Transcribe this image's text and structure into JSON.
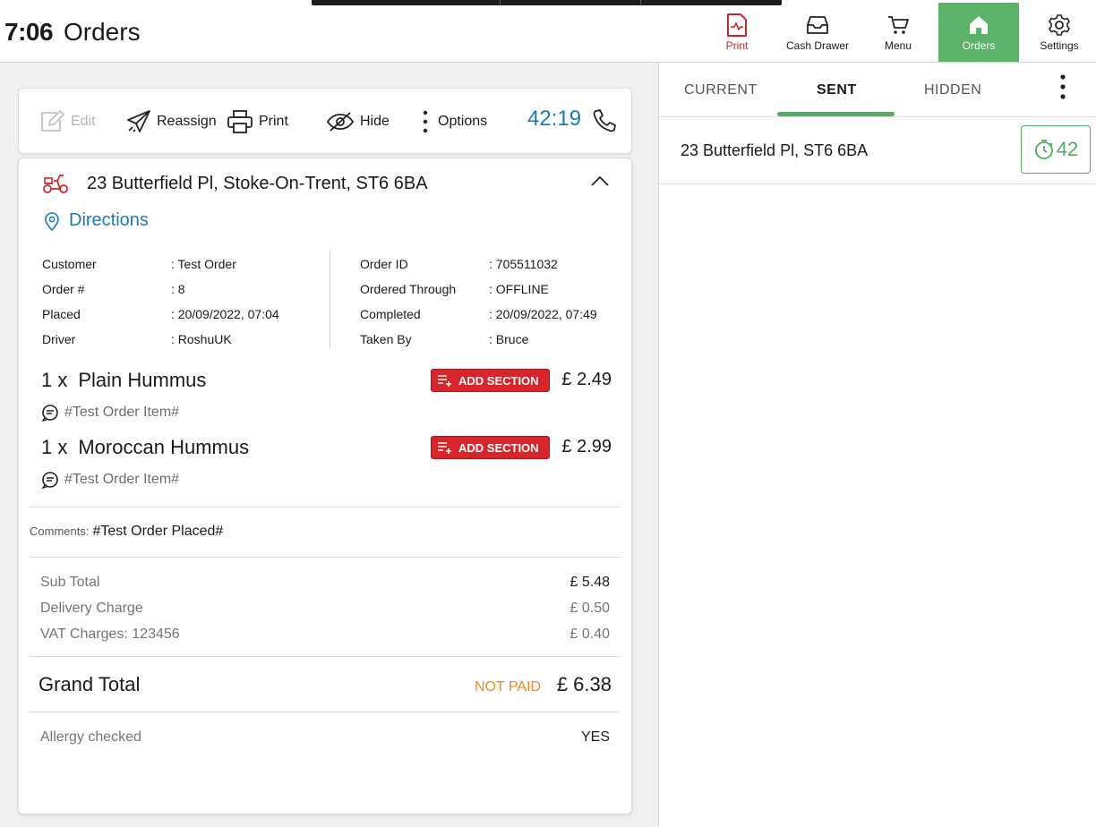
{
  "header": {
    "clock": "7:06",
    "title": "Orders",
    "nav": [
      {
        "label": "Print",
        "icon": "print-receipt-icon",
        "color": "#c9262a"
      },
      {
        "label": "Cash Drawer",
        "icon": "cash-drawer-icon"
      },
      {
        "label": "Menu",
        "icon": "cart-icon"
      },
      {
        "label": "Orders",
        "icon": "home-icon",
        "active": true,
        "color": "#5bb36a"
      },
      {
        "label": "Settings",
        "icon": "gear-icon"
      }
    ]
  },
  "toolbar": {
    "edit": "Edit",
    "reassign": "Reassign",
    "print": "Print",
    "hide": "Hide",
    "options": "Options",
    "timer": "42:19"
  },
  "order": {
    "address": "23 Butterfield Pl, Stoke-On-Trent, ST6 6BA",
    "directions": "Directions",
    "meta_left": [
      {
        "k": "Customer",
        "v": ": Test Order"
      },
      {
        "k": "Order #",
        "v": ": 8"
      },
      {
        "k": "Placed",
        "v": ": 20/09/2022, 07:04"
      },
      {
        "k": "Driver",
        "v": ": RoshuUK"
      }
    ],
    "meta_right": [
      {
        "k": "Order ID",
        "v": ": 705511032"
      },
      {
        "k": "Ordered Through",
        "v": ": OFFLINE"
      },
      {
        "k": "Completed",
        "v": ": 20/09/2022, 07:49"
      },
      {
        "k": "Taken By",
        "v": ": Bruce"
      }
    ],
    "items": [
      {
        "qty": "1 x",
        "name": "Plain Hummus",
        "button": "ADD SECTION",
        "price": "£ 2.49",
        "note": "#Test Order Item#"
      },
      {
        "qty": "1 x",
        "name": "Moroccan Hummus",
        "button": "ADD SECTION",
        "price": "£ 2.99",
        "note": "#Test Order Item#"
      }
    ],
    "comments_label": "Comments:",
    "comments": "#Test Order Placed#",
    "summary": [
      {
        "k": "Sub Total",
        "v": "£ 5.48"
      },
      {
        "k": "Delivery Charge",
        "v": "£ 0.50"
      },
      {
        "k": "VAT Charges: 123456",
        "v": "£ 0.40"
      }
    ],
    "grand_total_label": "Grand Total",
    "payment_status": "NOT PAID",
    "grand_total": "£ 6.38",
    "allergy_label": "Allergy checked",
    "allergy_value": "YES"
  },
  "right_panel": {
    "tabs": [
      "CURRENT",
      "SENT",
      "HIDDEN"
    ],
    "active_tab": "SENT",
    "orders": [
      {
        "address": "23 Butterfield Pl, ST6 6BA",
        "timer": "42"
      }
    ]
  },
  "colors": {
    "accent_green": "#4fae60",
    "link_blue": "#1b7bb6",
    "danger_red": "#d6262b",
    "warning_orange": "#f08a1c"
  }
}
